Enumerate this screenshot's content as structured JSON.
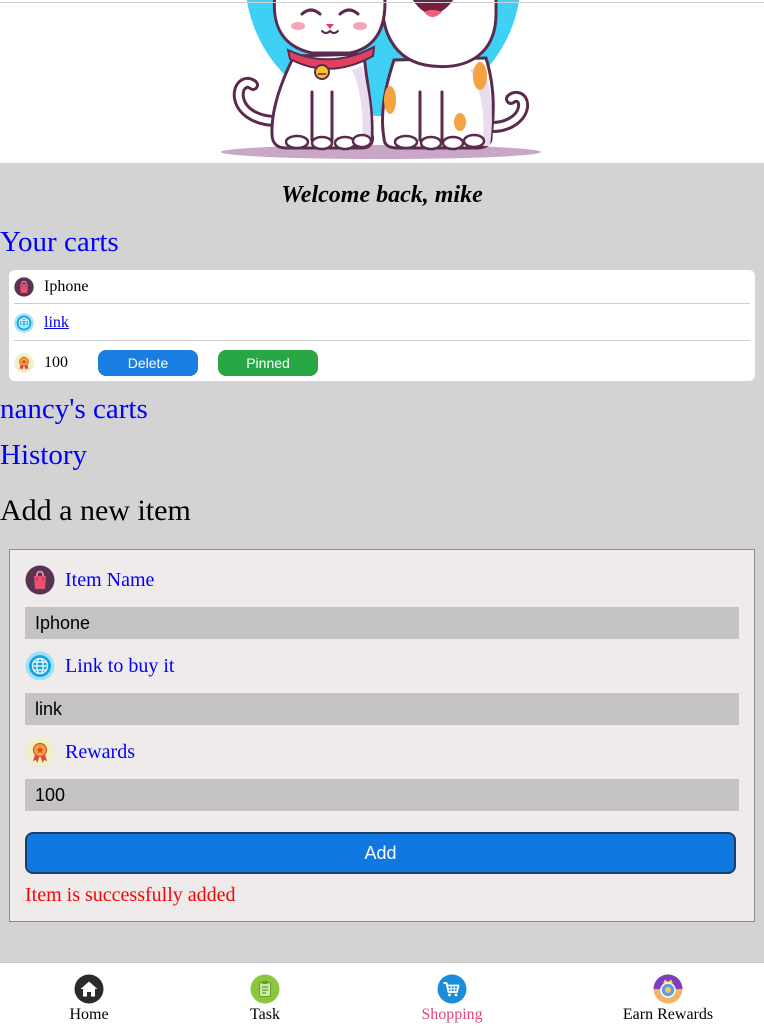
{
  "header": {
    "welcome": "Welcome back, mike"
  },
  "carts": {
    "your_carts_title": "Your carts",
    "items": [
      {
        "name_icon": "bag-icon",
        "name": "Iphone",
        "link_icon": "globe-icon",
        "link_text": "link",
        "rewards_icon": "reward-icon",
        "rewards": "100",
        "delete_label": "Delete",
        "pinned_label": "Pinned"
      }
    ],
    "other_carts_title": "nancy's carts",
    "history_title": "History"
  },
  "form": {
    "title": "Add a new item",
    "item_name_icon": "bag-icon",
    "item_name_label": "Item Name",
    "item_name_value": "Iphone",
    "link_icon": "globe-icon",
    "link_label": "Link to buy it",
    "link_value": "link",
    "rewards_icon": "reward-icon",
    "rewards_label": "Rewards",
    "rewards_value": "100",
    "add_label": "Add",
    "status_message": "Item is successfully added"
  },
  "nav": {
    "items": [
      {
        "label": "Home",
        "icon": "home-icon",
        "active": false
      },
      {
        "label": "Task",
        "icon": "task-icon",
        "active": false
      },
      {
        "label": "Shopping",
        "icon": "shopping-cart-icon",
        "active": true
      },
      {
        "label": "Earn Rewards",
        "icon": "earn-rewards-icon",
        "active": false
      }
    ]
  },
  "colors": {
    "page-bg": "#d3d3d3",
    "link": "#0000ff",
    "delete-button": "#1a7de2",
    "pinned-button": "#28a745",
    "add-button": "#1178e2",
    "form-bg": "#efebeb",
    "status-text": "#ff0000",
    "active-nav": "#e0447c"
  }
}
